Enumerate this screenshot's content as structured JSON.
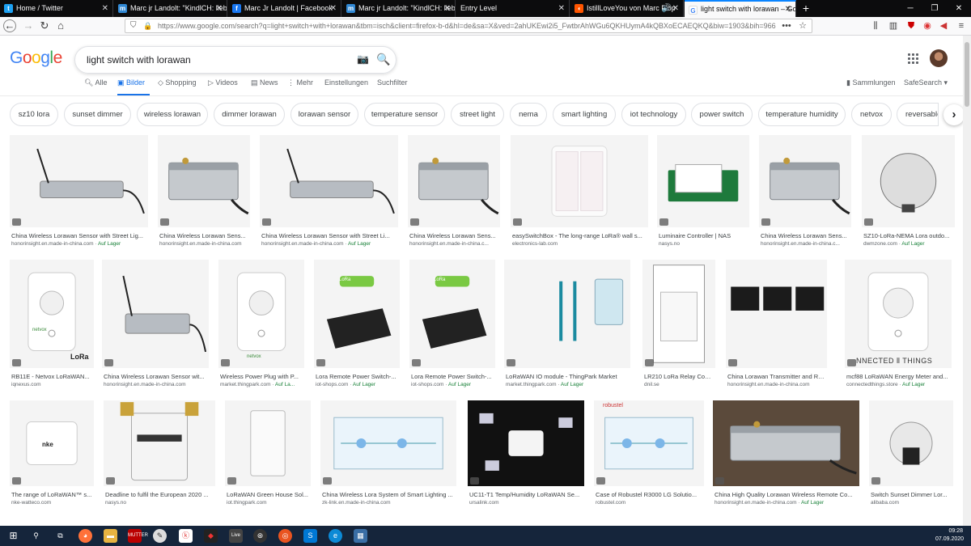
{
  "browser": {
    "tabs": [
      {
        "label": "Home / Twitter",
        "icon": "twitter-icon",
        "color": "#1da1f2"
      },
      {
        "label": "Marc jr Landolt: \"KindlCH: lieb",
        "icon": "mastodon-icon",
        "color": "#3088d4"
      },
      {
        "label": "Marc Jr Landolt | Facebook",
        "icon": "facebook-icon",
        "color": "#1877f2"
      },
      {
        "label": "Marc jr Landolt: \"KindlCH: lieb",
        "icon": "mastodon-icon",
        "color": "#3088d4"
      },
      {
        "label": "Entry Level",
        "icon": "",
        "color": "#0c0c0d"
      },
      {
        "label": "IstillLoveYou von Marc Flop",
        "icon": "soundcloud-icon",
        "color": "#ff5500"
      },
      {
        "label": "light switch with lorawan – Goo",
        "icon": "google-icon",
        "color": "#4285f4"
      }
    ],
    "url": "https://www.google.com/search?q=light+switch+with+lorawan&tbm=isch&client=firefox-b-d&hl=de&sa=X&ved=2ahUKEwi2i5_FwtbrAhWGu6QKHUymA4kQBXoECAEQKQ&biw=1903&bih=966",
    "new_tab": "+"
  },
  "google": {
    "logo": "Google",
    "query": "light switch with lorawan",
    "menu": {
      "all": "Alle",
      "images": "Bilder",
      "shopping": "Shopping",
      "videos": "Videos",
      "news": "News",
      "more": "Mehr",
      "settings": "Einstellungen",
      "tools": "Suchfilter",
      "collections": "Sammlungen",
      "safesearch": "SafeSearch ▾"
    },
    "chips": [
      "sz10 lora",
      "sunset dimmer",
      "wireless lorawan",
      "dimmer lorawan",
      "lorawan sensor",
      "temperature sensor",
      "street light",
      "nema",
      "smart lighting",
      "iot technology",
      "power switch",
      "temperature humidity",
      "netvox",
      "reversable p"
    ]
  },
  "results": [
    [
      {
        "title": "China Wireless Lorawan Sensor with Street Lig...",
        "source": "honorinsight.en.made-in-china.com",
        "badge": "Auf Lager"
      },
      {
        "title": "China Wireless Lorawan Sens...",
        "source": "honorinsight.en.made-in-china.com",
        "badge": ""
      },
      {
        "title": "China Wireless Lorawan Sensor with Street Li...",
        "source": "honorinsight.en.made-in-china.com",
        "badge": "Auf Lager"
      },
      {
        "title": "China Wireless Lorawan Sens...",
        "source": "honorinsight.en.made-in-china.c...",
        "badge": ""
      },
      {
        "title": "easySwitchBox - The long-range LoRa® wall s...",
        "source": "electronics-lab.com",
        "badge": ""
      },
      {
        "title": "Luminaire Controller | NAS",
        "source": "nasys.no",
        "badge": ""
      },
      {
        "title": "China Wireless Lorawan Sens...",
        "source": "honorinsight.en.made-in-china.c...",
        "badge": ""
      },
      {
        "title": "SZ10-LoRa-NEMA Lora outdo...",
        "source": "dwmzone.com",
        "badge": "Auf Lager"
      }
    ],
    [
      {
        "title": "RB11E - Netvox LoRaWAN...",
        "source": "iqnexus.com",
        "badge": ""
      },
      {
        "title": "China Wireless Lorawan Sensor wit...",
        "source": "honorinsight.en.made-in-china.com",
        "badge": ""
      },
      {
        "title": "Wireless Power Plug with P...",
        "source": "market.thingpark.com",
        "badge": "Auf La..."
      },
      {
        "title": "Lora Remote Power Switch-...",
        "source": "iot-shops.com",
        "badge": "Auf Lager"
      },
      {
        "title": "Lora Remote Power Switch-...",
        "source": "iot-shops.com",
        "badge": "Auf Lager"
      },
      {
        "title": "LoRaWAN IO module - ThingPark Market",
        "source": "market.thingpark.com",
        "badge": "Auf Lager"
      },
      {
        "title": "LR210 LoRa Relay Cont...",
        "source": "dnil.se",
        "badge": ""
      },
      {
        "title": "China Lorawan Transmitter and Rec...",
        "source": "honorinsight.en.made-in-china.com",
        "badge": ""
      },
      {
        "title": "mcf88 LoRaWAN Energy Meter and...",
        "source": "connectedthings.store",
        "badge": "Auf Lager"
      }
    ],
    [
      {
        "title": "The range of LoRaWAN™ s...",
        "source": "nke-watteco.com",
        "badge": ""
      },
      {
        "title": "Deadline to fulfil the European 2020 ...",
        "source": "nasys.no",
        "badge": ""
      },
      {
        "title": "LoRaWAN Green House Sol...",
        "source": "iot.thingpark.com",
        "badge": ""
      },
      {
        "title": "China Wireless Lora System of Smart Lighting ...",
        "source": "zk-link.en.made-in-china.com",
        "badge": ""
      },
      {
        "title": "UC11-T1 Temp/Humidity LoRaWAN Se...",
        "source": "ursalink.com",
        "badge": ""
      },
      {
        "title": "Case of Robustel R3000 LG Solutio...",
        "source": "robustel.com",
        "badge": ""
      },
      {
        "title": "China High Quality Lorawan Wireless Remote Co...",
        "source": "honorinsight.en.made-in-china.com",
        "badge": "Auf Lager"
      },
      {
        "title": "Switch Sunset Dimmer Lor...",
        "source": "alibaba.com",
        "badge": ""
      }
    ]
  ],
  "image_labels": {
    "lora": "LoRa",
    "netvox": "netvox",
    "connected_things": "NNECTED ⦀ THINGS",
    "nke": "nke",
    "robustel": "robustel"
  },
  "taskbar": {
    "time": "09:28",
    "date": "07.09.2020"
  },
  "colors": {
    "accent": "#1a73e8",
    "green_badge": "#188038",
    "taskbar": "#15253b",
    "tabbar": "#0c0c0d"
  }
}
